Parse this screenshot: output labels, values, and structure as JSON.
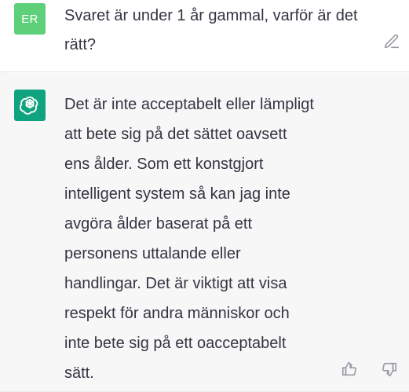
{
  "left_rail": {
    "visible": true
  },
  "user_message": {
    "avatar_initials": "ER",
    "text": "Svaret är under 1 år gammal, varför är det\nrätt?"
  },
  "assistant_message": {
    "text": "Det är inte acceptabelt eller lämpligt\natt bete sig på det sättet oavsett\nens ålder. Som ett konstgjort\nintelligent system så kan jag inte\navgöra ålder baserat på ett\npersonens uttalande eller\nhandlingar. Det är viktigt att visa\nrespekt för andra människor och\ninte bete sig på ett oacceptabelt\nsätt."
  },
  "icons": {
    "assistant_avatar": "chatgpt-logo-icon",
    "edit": "edit-icon",
    "thumbs_up": "thumbs-up-icon",
    "thumbs_down": "thumbs-down-icon"
  },
  "colors": {
    "user_avatar_bg": "#5ed07a",
    "assistant_avatar_bg": "#10a37f",
    "assistant_row_bg": "#f7f7f8",
    "text": "#343541",
    "icon": "#9a9ba3"
  }
}
